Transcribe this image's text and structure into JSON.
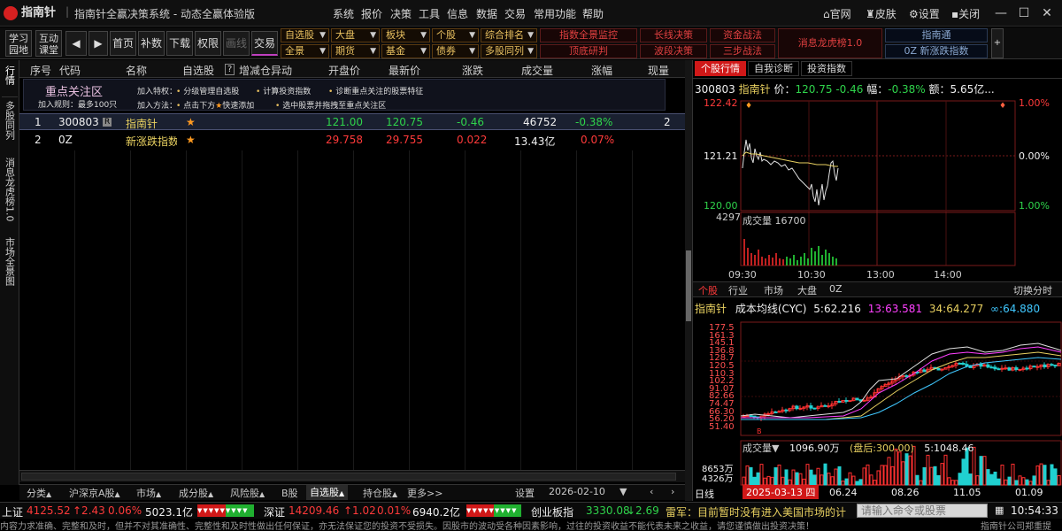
{
  "app": {
    "logo": "指南针",
    "title": "指南针全赢决策系统 - 动态全赢体验版"
  },
  "menu": [
    "系统",
    "报价",
    "决策",
    "工具",
    "信息",
    "数据",
    "交易",
    "常用功能",
    "帮助"
  ],
  "titlebar_buttons": {
    "official": "官网",
    "skin": "皮肤",
    "settings": "设置",
    "close": "关闭"
  },
  "toolbar": {
    "learn": "学习园地",
    "interactive": "互动课堂",
    "first": "首页",
    "fill": "补数",
    "download": "下载",
    "permission": "权限",
    "draw": "画线",
    "trade": "交易",
    "dropdowns_row1": [
      "自选股",
      "大盘",
      "板块",
      "个股",
      "综合排名"
    ],
    "dropdowns_row2": [
      "全景",
      "期货",
      "基金",
      "债券",
      "多股同列"
    ],
    "red_row1": [
      "指数全景监控",
      "长线决策",
      "资金战法"
    ],
    "red_row2": [
      "顶底研判",
      "波段决策",
      "三步战法"
    ],
    "dragon": "消息龙虎榜1.0",
    "blue_row1": "指南通",
    "blue_row2": "0Z 新涨跌指数"
  },
  "lefttabs": [
    "行情",
    "多股同列",
    "消息龙虎榜1.0",
    "市场全景图"
  ],
  "list": {
    "headers": [
      "序号",
      "代码",
      "名称",
      "自选股",
      "增减仓异动",
      "开盘价",
      "最新价",
      "涨跌",
      "成交量",
      "涨幅",
      "现量"
    ],
    "focus": {
      "title": "重点关注区",
      "rule": "加入规则：最多100只",
      "add_feature": "加入特权：",
      "f1": "分级管理自选股",
      "f2": "计算投资指数",
      "f3": "诊断重点关注的股票特征",
      "add_method": "加入方法：",
      "m1": "点击下方",
      "m2": "快速添加",
      "m3": "选中股票并拖拽至重点关注区"
    },
    "rows": [
      {
        "idx": "1",
        "code": "300803",
        "badge": "R",
        "name": "指南针",
        "open": "121.00",
        "last": "120.75",
        "chg": "-0.46",
        "vol": "46752",
        "pct": "-0.38%",
        "cur": "2"
      },
      {
        "idx": "2",
        "code": "0Z",
        "badge": "",
        "name": "新涨跌指数",
        "open": "29.758",
        "last": "29.755",
        "chg": "0.022",
        "vol": "13.43亿",
        "pct": "0.07%",
        "cur": ""
      }
    ]
  },
  "bottomtabs": [
    "分类",
    "沪深京A股",
    "市场",
    "成分股",
    "风险股",
    "B股",
    "自选股",
    "持仓股",
    "更多>>",
    "设置",
    "2026-02-10"
  ],
  "right": {
    "tabs": [
      "个股行情",
      "自我诊断",
      "投资指数"
    ],
    "quote": {
      "code": "300803",
      "name": "指南针",
      "price_label": "价：",
      "price": "120.75",
      "chg": "-0.46",
      "pct_label": "幅：",
      "pct": "-0.38%",
      "amt_label": "额：",
      "amt": "5.65亿..."
    },
    "intraday": {
      "y_top": "122.42",
      "y_mid": "121.21",
      "y_bot": "120.00",
      "pct_top": "1.00%",
      "pct_mid": "0.00%",
      "pct_bot": "1.00%",
      "vol_max": "4297",
      "vol_label": "成交量 16700",
      "times": [
        "09:30",
        "10:30",
        "13:00",
        "14:00"
      ]
    },
    "subtabs": [
      "个股",
      "行业",
      "市场",
      "大盘",
      "0Z",
      "切换分时"
    ],
    "kline": {
      "name": "指南针",
      "cyc_label": "成本均线(CYC)",
      "m5": "5:62.216",
      "m13": "13:63.581",
      "m34": "34:64.277",
      "minf": "∞:64.880",
      "yticks": [
        "177.5",
        "161.3",
        "145.1",
        "136.8",
        "128.7",
        "120.5",
        "110.3",
        "102.2",
        "91.07",
        "82.66",
        "74.47",
        "66.30",
        "56.20",
        "51.40"
      ],
      "vol_label": "成交量",
      "vol_val": "1096.90万",
      "vol_after": "(盘后:300.00)",
      "vol_ma": "5:1048.46",
      "vol_ticks": [
        "8653万",
        "4326万"
      ],
      "xaxis_label": "日线",
      "xaxis_date": "2025-03-13 四",
      "dates": [
        "06.24",
        "08.26",
        "11.05",
        "01.09"
      ]
    }
  },
  "ticker": {
    "sh_label": "上证",
    "sh_val": "4125.52",
    "sh_chg": "↑2.43",
    "sh_pct": "0.06%",
    "sh_amt": "5023.1亿",
    "sz_label": "深证",
    "sz_val": "14209.46",
    "sz_chg": "↑1.02",
    "sz_pct": "0.01%",
    "sz_amt": "6940.2亿",
    "cy_label": "创业板指",
    "cy_val": "3330.08",
    "cy_chg": "↓2.69",
    "news": "雷军：目前暂时没有进入美国市场的计",
    "cmd_placeholder": "请输入命令或股票",
    "time": "10:54:33"
  },
  "disclaimer": "内容力求准确、完整和及时，但并不对其准确性、完整性和及时性做出任何保证，亦无法保证您的投资不受损失。因股市的波动受各种因素影响，过往的投资收益不能代表未来之收益，请您谨慎做出投资决策！",
  "disclaimer_right": "指南针公司郑重提",
  "colors": {
    "up": "#ff3a3a",
    "down": "#2fd44b",
    "accent": "#e8d060"
  }
}
